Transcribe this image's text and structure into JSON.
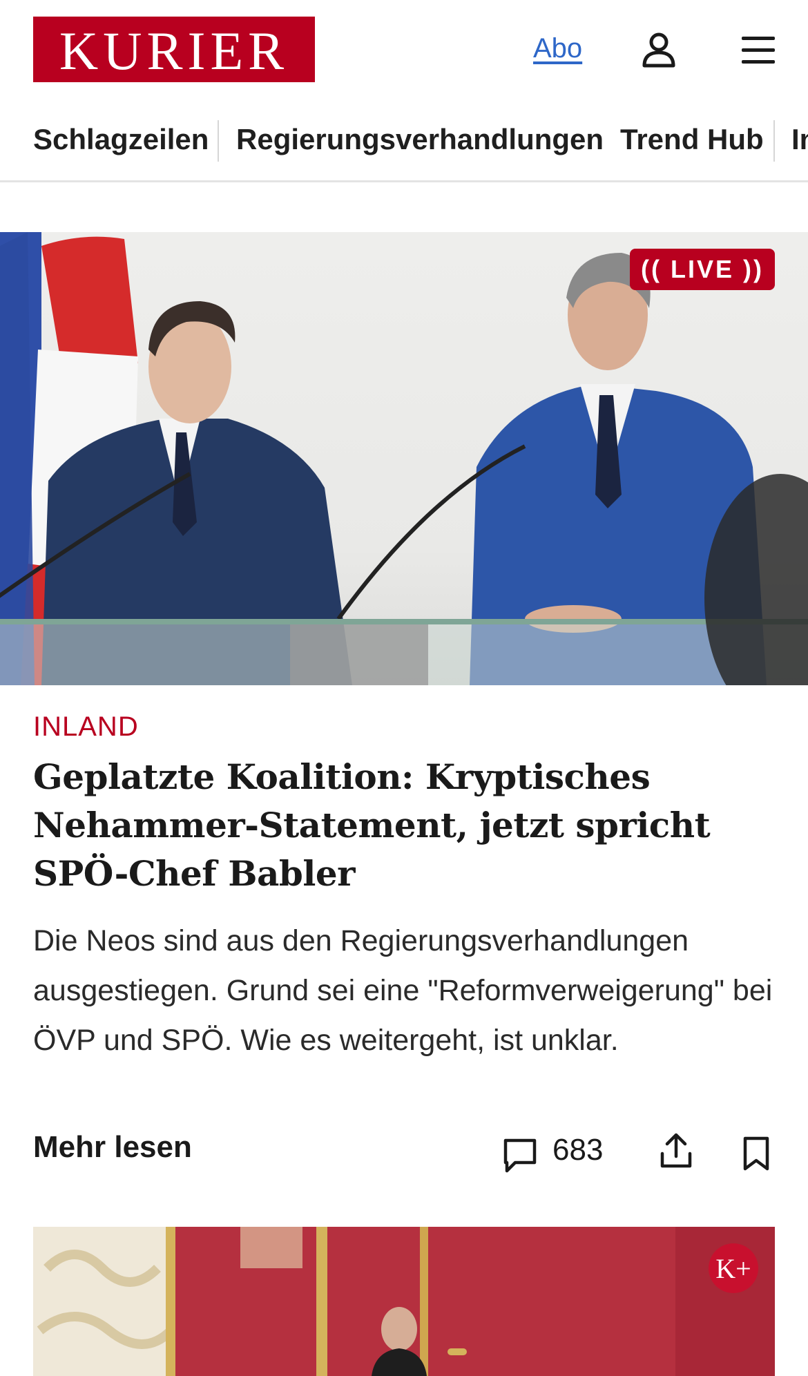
{
  "header": {
    "logo_text": "KURIER",
    "abo_label": "Abo",
    "account_icon": "user-icon",
    "menu_icon": "hamburger-menu-icon"
  },
  "nav": {
    "items": [
      "Schlagzeilen",
      "Regierungsverhandlungen",
      "Trend Hub",
      "In"
    ]
  },
  "hero": {
    "badge": "(( LIVE ))"
  },
  "article": {
    "kicker": "INLAND",
    "headline": "Geplatzte Koalition: Kryptisches Neham­mer-Statement, jetzt spricht SPÖ-Chef Babler",
    "teaser": "Die Neos sind aus den Regierungsverhandlungen ausgestiegen. Grund sei eine \"Reformverweigerung\" bei ÖVP und SPÖ. Wie es weitergeht, ist unklar.",
    "more_label": "Mehr lesen",
    "comment_count": "683"
  },
  "second_card": {
    "badge": "K+"
  },
  "colors": {
    "brand": "#b8001f",
    "link": "#2e67c8"
  }
}
